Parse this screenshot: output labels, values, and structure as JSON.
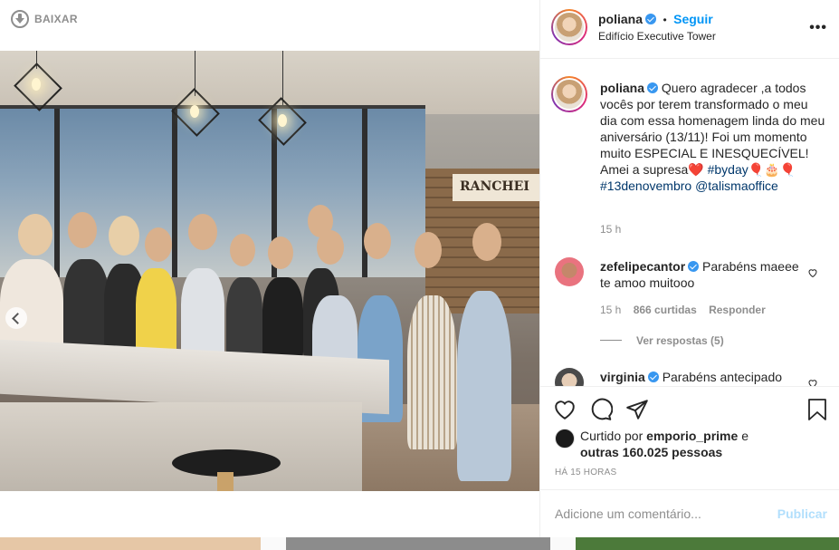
{
  "media": {
    "download_label": "BAIXAR",
    "sign_text": "RANCHEI"
  },
  "header": {
    "username": "poliana",
    "separator": "•",
    "follow_label": "Seguir",
    "location": "Edifício Executive Tower",
    "more_icon": "more-icon"
  },
  "caption": {
    "username": "poliana",
    "text": "Quero agradecer ,a todos vocês por terem transformado o meu dia com essa homenagem linda do meu aniversário (13/11)! Foi um momento muito ESPECIAL E INESQUECÍVEL! Amei a supresa❤️",
    "hashtag1": "#byday🎈🎂🎈",
    "hashtag2": "#13denovembro",
    "mention": "@talismaoffice",
    "time": "15 h"
  },
  "comments": [
    {
      "username": "zefelipecantor",
      "text": "Parabéns maeee te amoo muitooo",
      "time": "15 h",
      "likes": "866 curtidas",
      "reply_label": "Responder",
      "view_replies": "Ver respostas (5)"
    },
    {
      "username": "virginia",
      "text": "Parabéns antecipado"
    }
  ],
  "likes": {
    "prefix": "Curtido por",
    "user": "emporio_prime",
    "connector": "e",
    "others": "outras 160.025 pessoas"
  },
  "timestamp": "HÁ 15 HORAS",
  "add_comment": {
    "placeholder": "Adicione um comentário...",
    "publish_label": "Publicar"
  },
  "colors": {
    "link_blue": "#0095f6",
    "verified_blue": "#3897f0",
    "hashtag": "#00376b",
    "muted": "#8e8e8e"
  }
}
